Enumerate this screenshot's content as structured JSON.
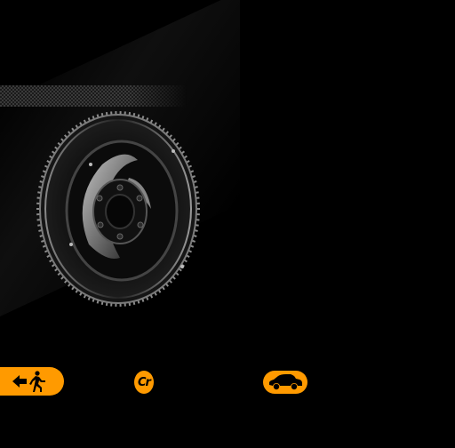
{
  "app": {
    "background_color": "#000000",
    "accent_color": "#ff9a00"
  },
  "hero": {
    "image": "flywheel-gear-image",
    "decoration": "checkered-strip"
  },
  "toolbar": {
    "exit_icon": "exit-door-running-person-icon",
    "credits_icon": "cr-credits-icon",
    "credits_label": "Cr",
    "car_icon": "car-icon"
  }
}
